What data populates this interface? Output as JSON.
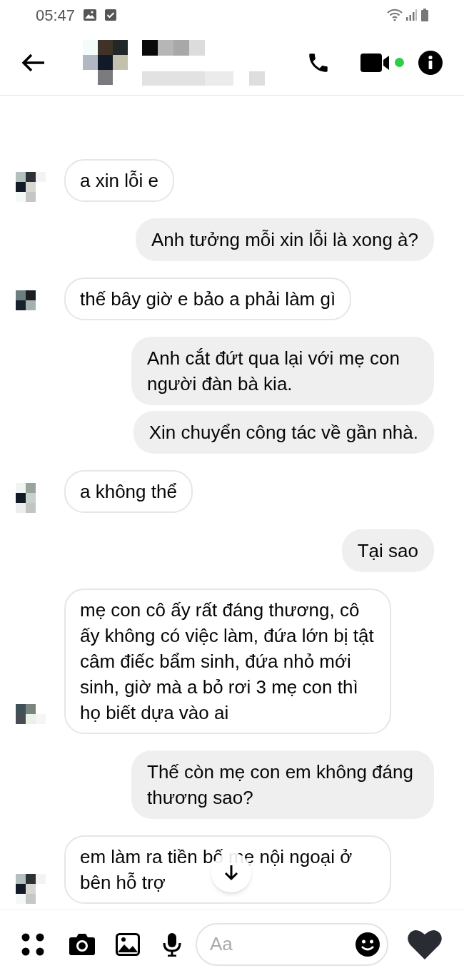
{
  "status_bar": {
    "time": "05:47"
  },
  "header": {
    "contact_online": true
  },
  "messages": [
    {
      "kind": "received",
      "text": "a xin lỗi e"
    },
    {
      "kind": "sent",
      "text": "Anh tưởng mỗi xin lỗi là xong à?"
    },
    {
      "kind": "received",
      "text": "thế bây giờ e bảo a phải làm gì"
    },
    {
      "kind": "sent",
      "text": "Anh cắt đứt qua lại với mẹ con người đàn bà kia."
    },
    {
      "kind": "sent",
      "text": "Xin chuyển công tác về gần nhà."
    },
    {
      "kind": "received",
      "text": "a không thể"
    },
    {
      "kind": "sent",
      "text": "Tại sao"
    },
    {
      "kind": "received",
      "text": "mẹ con cô ấy rất đáng thương, cô ấy không có việc làm, đứa lớn bị tật câm điếc bẩm sinh, đứa nhỏ mới sinh, giờ mà a bỏ rơi 3 mẹ con thì họ biết dựa vào ai"
    },
    {
      "kind": "sent",
      "text": "Thế còn mẹ con em không đáng thương sao?"
    },
    {
      "kind": "received",
      "text": "em làm ra tiền bố mẹ nội ngoại ở bên hỗ trợ"
    }
  ],
  "composer": {
    "placeholder": "Aa"
  }
}
